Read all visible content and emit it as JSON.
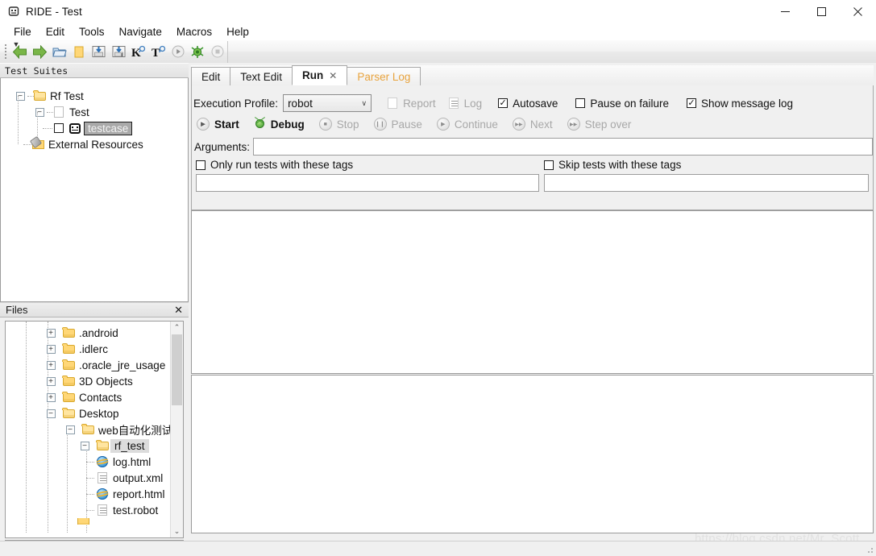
{
  "window": {
    "title": "RIDE - Test",
    "icon": "robot-face-icon",
    "controls": {
      "minimize": "–",
      "maximize": "☐",
      "close": "✕"
    }
  },
  "menubar": {
    "items": [
      {
        "label": "File"
      },
      {
        "label": "Edit"
      },
      {
        "label": "Tools"
      },
      {
        "label": "Navigate"
      },
      {
        "label": "Macros"
      },
      {
        "label": "Help"
      }
    ]
  },
  "toolbar": {
    "buttons": [
      {
        "name": "back-arrow-icon",
        "glyph": "←"
      },
      {
        "name": "forward-arrow-icon",
        "glyph": "→"
      },
      {
        "name": "open-folder-icon",
        "glyph": "▭"
      },
      {
        "name": "new-folder-icon",
        "glyph": "▭"
      },
      {
        "name": "save-icon",
        "glyph": "↓"
      },
      {
        "name": "save-all-icon",
        "glyph": "↓"
      },
      {
        "name": "search-keyword-icon",
        "glyph": "K"
      },
      {
        "name": "search-test-icon",
        "glyph": "T"
      },
      {
        "name": "run-icon",
        "glyph": "▶"
      },
      {
        "name": "debug-bug-icon",
        "glyph": "✻"
      },
      {
        "name": "stop-icon",
        "glyph": "■"
      }
    ]
  },
  "test_suites": {
    "header": "Test Suites",
    "tree": [
      {
        "label": "Rf Test",
        "icon": "folder-icon",
        "expander": "−",
        "depth": 0,
        "selected": false,
        "checkbox": false
      },
      {
        "label": "Test",
        "icon": "document-icon",
        "expander": "−",
        "depth": 1,
        "selected": false,
        "checkbox": false
      },
      {
        "label": "testcase",
        "icon": "robot-face-icon",
        "expander": "",
        "depth": 2,
        "selected": true,
        "checkbox": true
      },
      {
        "label": "External Resources",
        "icon": "external-resources-icon",
        "expander": "",
        "depth": 1,
        "selected": false,
        "checkbox": false
      }
    ]
  },
  "files": {
    "header": "Files",
    "close_glyph": "✕",
    "tree": [
      {
        "label": ".android",
        "icon": "folder-icon",
        "expander": "+",
        "depth": 2,
        "selected": false
      },
      {
        "label": ".idlerc",
        "icon": "folder-icon",
        "expander": "+",
        "depth": 2,
        "selected": false
      },
      {
        "label": ".oracle_jre_usage",
        "icon": "folder-icon",
        "expander": "+",
        "depth": 2,
        "selected": false
      },
      {
        "label": "3D Objects",
        "icon": "folder-icon",
        "expander": "+",
        "depth": 2,
        "selected": false
      },
      {
        "label": "Contacts",
        "icon": "folder-icon",
        "expander": "+",
        "depth": 2,
        "selected": false
      },
      {
        "label": "Desktop",
        "icon": "folder-icon",
        "expander": "−",
        "depth": 2,
        "selected": false
      },
      {
        "label": "web自动化测试",
        "icon": "folder-icon",
        "expander": "−",
        "depth": 3,
        "selected": false
      },
      {
        "label": "rf_test",
        "icon": "folder-icon",
        "expander": "−",
        "depth": 4,
        "selected": true
      },
      {
        "label": "log.html",
        "icon": "internet-explorer-icon",
        "expander": "",
        "depth": 5,
        "selected": false
      },
      {
        "label": "output.xml",
        "icon": "xml-document-icon",
        "expander": "",
        "depth": 5,
        "selected": false
      },
      {
        "label": "report.html",
        "icon": "internet-explorer-icon",
        "expander": "",
        "depth": 5,
        "selected": false
      },
      {
        "label": "test.robot",
        "icon": "robot-document-icon",
        "expander": "",
        "depth": 5,
        "selected": false
      }
    ],
    "scroll": {
      "up_glyph": "⌃",
      "down_glyph": "⌄",
      "left_glyph": "‹",
      "right_glyph": "›"
    }
  },
  "tabs": [
    {
      "label": "Edit",
      "active": false,
      "muted": false,
      "closable": false
    },
    {
      "label": "Text Edit",
      "active": false,
      "muted": false,
      "closable": false
    },
    {
      "label": "Run",
      "active": true,
      "muted": false,
      "closable": true,
      "close_glyph": "✕"
    },
    {
      "label": "Parser Log",
      "active": false,
      "muted": true,
      "closable": false
    }
  ],
  "run_panel": {
    "execution_profile_label": "Execution Profile:",
    "execution_profile_value": "robot",
    "execution_profile_chevron": "∨",
    "report_label": "Report",
    "log_label": "Log",
    "checkboxes": [
      {
        "label": "Autosave",
        "checked": true,
        "mark": "✓"
      },
      {
        "label": "Pause on failure",
        "checked": false,
        "mark": ""
      },
      {
        "label": "Show message log",
        "checked": true,
        "mark": "✓"
      }
    ],
    "controls": [
      {
        "label": "Start",
        "enabled": true,
        "icon": "play-icon",
        "glyph": "▶"
      },
      {
        "label": "Debug",
        "enabled": true,
        "icon": "bug-icon",
        "glyph": ""
      },
      {
        "label": "Stop",
        "enabled": false,
        "icon": "stop-icon",
        "glyph": "■"
      },
      {
        "label": "Pause",
        "enabled": false,
        "icon": "pause-icon",
        "glyph": "‖"
      },
      {
        "label": "Continue",
        "enabled": false,
        "icon": "play-icon",
        "glyph": "▶"
      },
      {
        "label": "Next",
        "enabled": false,
        "icon": "next-icon",
        "glyph": "▶▶"
      },
      {
        "label": "Step over",
        "enabled": false,
        "icon": "step-over-icon",
        "glyph": "▶▶"
      }
    ],
    "arguments_label": "Arguments:",
    "arguments_value": "",
    "only_run_tags_label": "Only run tests with these tags",
    "only_run_tags_checked": false,
    "only_run_tags_value": "",
    "skip_tags_label": "Skip tests with these tags",
    "skip_tags_checked": false,
    "skip_tags_value": ""
  },
  "output": {
    "console_text": "",
    "message_log_text": ""
  },
  "watermark": "https://blog.csdn.net/Mr_Scott"
}
